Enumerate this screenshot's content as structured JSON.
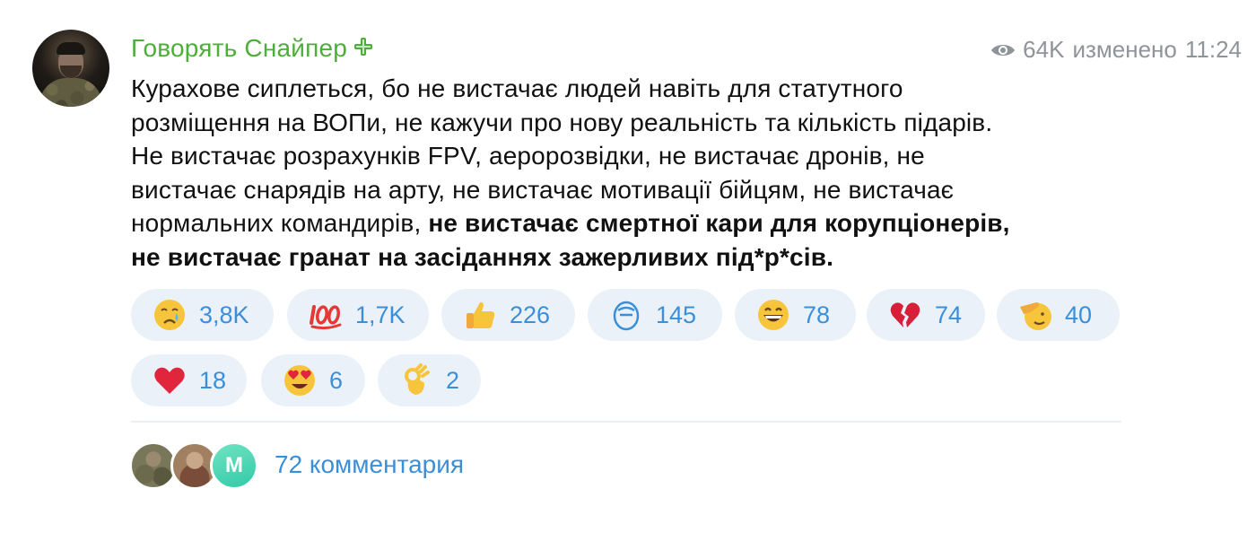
{
  "post": {
    "channel_name": "Говорять Снайпер",
    "badge_icon": "green-plus-icon",
    "views": "64K",
    "edited_label": "изменено",
    "time": "11:24",
    "message": {
      "lines": [
        {
          "text": "Курахове сиплеться, бо не вистачає людей навіть для статутного"
        },
        {
          "text": "розміщення на ВОПи, не кажучи про нову реальність та кількість підарів."
        },
        {
          "text": "Не вистачає розрахунків FPV, аеророзвідки, не вистачає дронів, не"
        },
        {
          "text": "вистачає снарядів на арту, не вистачає мотивації бійцям, не вистачає"
        },
        {
          "text": "нормальних командирів, ",
          "bold": "не вистачає смертної кари для корупціонерів,"
        },
        {
          "text": "",
          "bold": "не вистачає гранат на засіданнях зажерливих під*р*сів."
        }
      ]
    },
    "reactions": [
      {
        "emoji": "crying-face",
        "count": "3,8K"
      },
      {
        "emoji": "hundred-points",
        "count": "1,7K"
      },
      {
        "emoji": "thumbs-up",
        "count": "226"
      },
      {
        "emoji": "unknown-custom",
        "count": "145"
      },
      {
        "emoji": "grinning-face",
        "count": "78"
      },
      {
        "emoji": "broken-heart",
        "count": "74"
      },
      {
        "emoji": "saluting-face",
        "count": "40"
      },
      {
        "emoji": "red-heart",
        "count": "18"
      },
      {
        "emoji": "heart-eyes",
        "count": "6"
      },
      {
        "emoji": "ok-hand",
        "count": "2"
      }
    ],
    "comments": {
      "avatar_letter": "M",
      "label": "72 комментария"
    }
  },
  "colors": {
    "channel_name": "#4eae3b",
    "meta": "#8e9499",
    "reaction_bg": "#eaf1f8",
    "reaction_count": "#3b8fd8",
    "link": "#3b8fd8"
  }
}
